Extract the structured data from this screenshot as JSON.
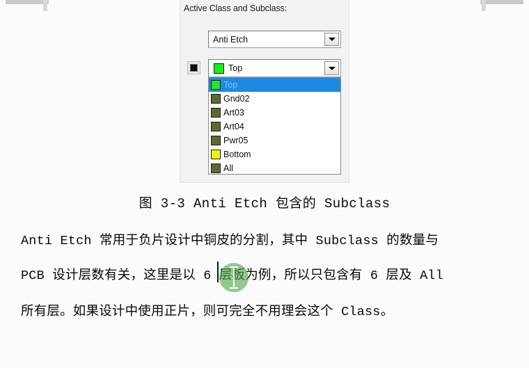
{
  "panel": {
    "title": "Active Class and Subclass:",
    "class_combo": {
      "value": "Anti Etch",
      "arrow_icon": "chevron-down-icon"
    },
    "subclass_combo": {
      "value": "Top",
      "swatch_color": "#1fe81f",
      "arrow_icon": "chevron-down-icon"
    },
    "toggle_button": {
      "icon": "filled-square-icon"
    },
    "dropdown": {
      "items": [
        {
          "label": "Top",
          "color": "#1fe81f",
          "selected": true
        },
        {
          "label": "Gnd02",
          "color": "#5a6b2e",
          "selected": false
        },
        {
          "label": "Art03",
          "color": "#5a6b2e",
          "selected": false
        },
        {
          "label": "Art04",
          "color": "#5a6b2e",
          "selected": false
        },
        {
          "label": "Pwr05",
          "color": "#5a6b2e",
          "selected": false
        },
        {
          "label": "Bottom",
          "color": "#f2f20c",
          "selected": false
        },
        {
          "label": "All",
          "color": "#5a6b2e",
          "selected": false
        }
      ],
      "selected_highlight_color": "#1c8ae0"
    }
  },
  "caption": "图 3-3 Anti Etch 包含的 Subclass",
  "body": {
    "line1": "Anti Etch 常用于负片设计中铜皮的分割，其中 Subclass 的数量与",
    "line2": "PCB 设计层数有关，这里是以 6 层板为例，所以只包含有 6 层及 All",
    "line3": "所有层。如果设计中使用正片，则可完全不用理会这个 Class。"
  },
  "cursor": {
    "halo_color": "#53a84a",
    "icon": "text-ibeam-cursor"
  }
}
